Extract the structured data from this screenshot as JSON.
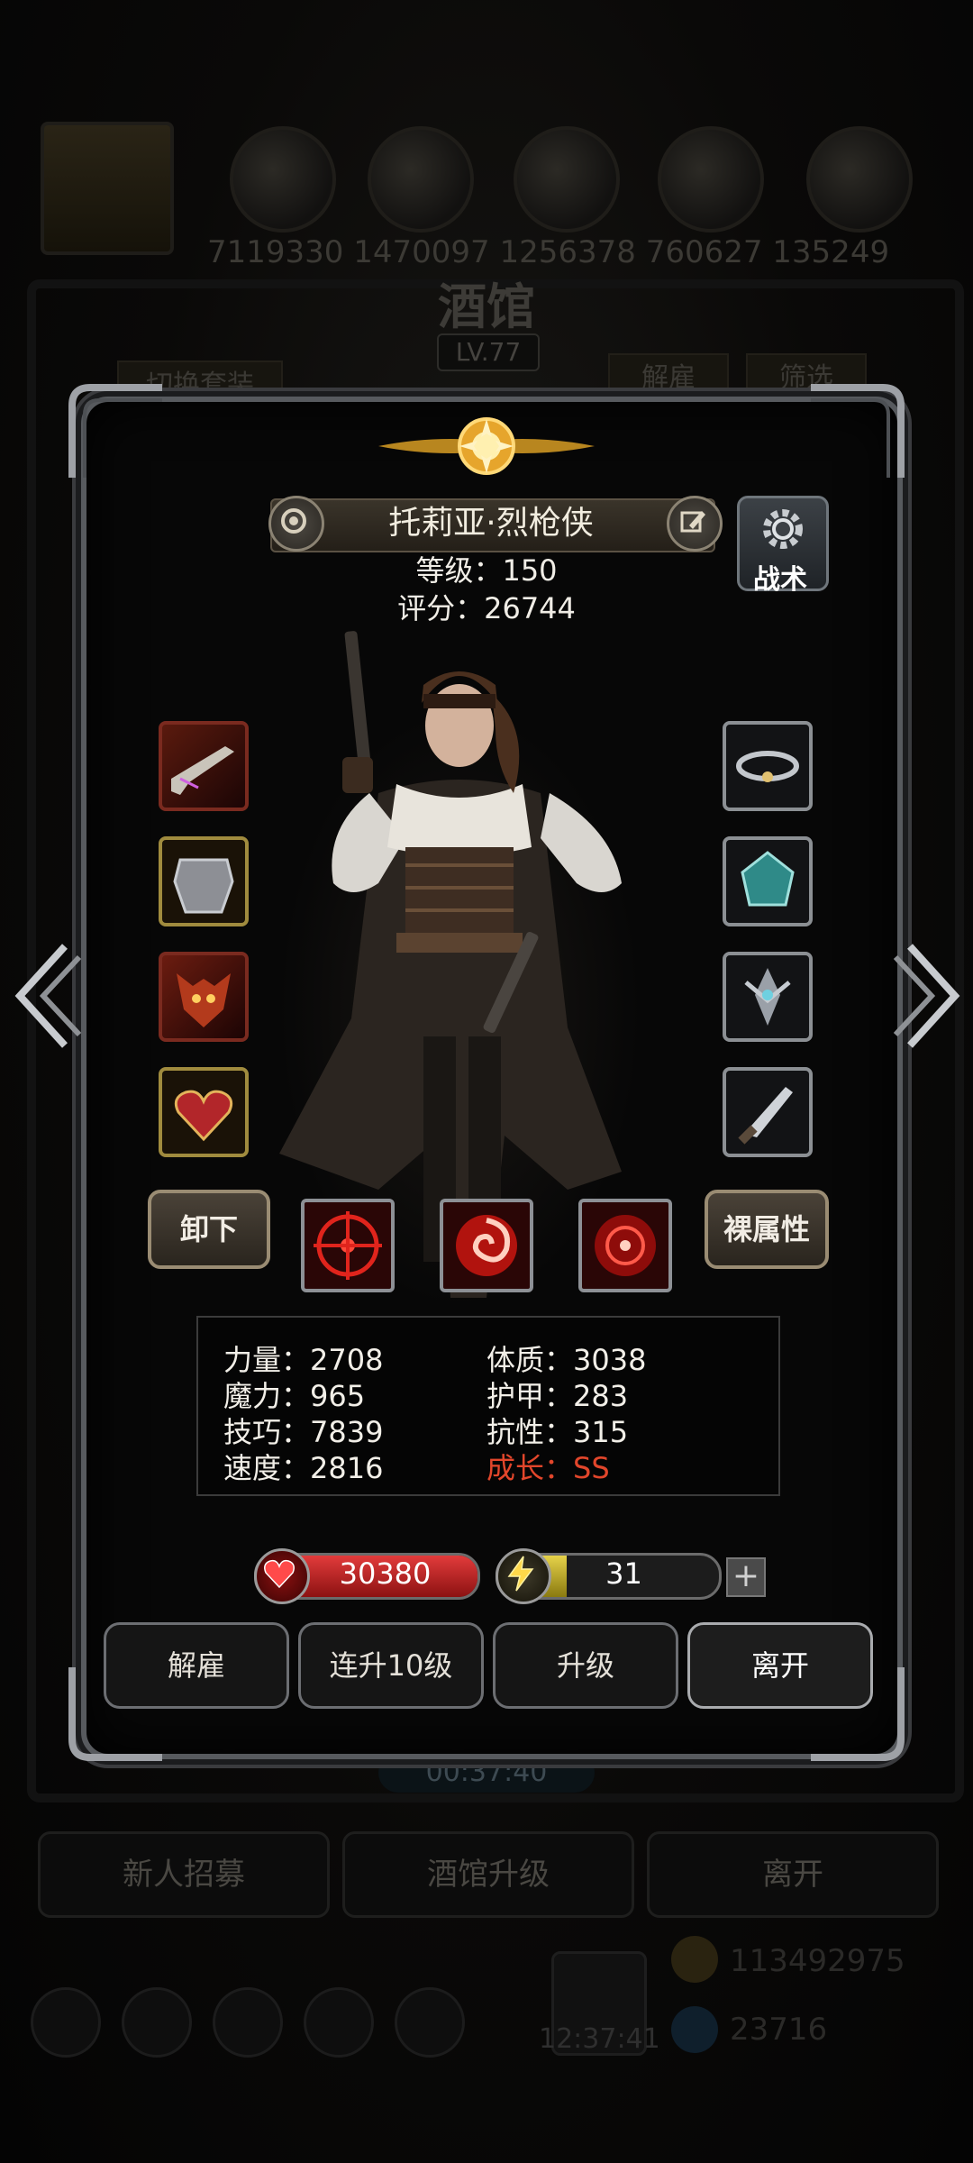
{
  "background": {
    "resource_numbers": "7119330 1470097 1256378 760627 135249",
    "tavern_title": "酒馆",
    "tavern_level": "LV.77",
    "switch_outfit": "切换套装",
    "dismiss": "解雇",
    "filter": "筛选",
    "timer": "00:37:40",
    "bottom_buttons": [
      "新人招募",
      "酒馆升级",
      "离开"
    ],
    "clock": "12:37:41",
    "gold": "113492975",
    "gems": "23716"
  },
  "hero": {
    "name": "托莉亚·烈枪侠",
    "level_label": "等级：150",
    "score_label": "评分：26744",
    "tactic": "战术"
  },
  "equipment": {
    "left": [
      "pistol-icon",
      "armor-icon",
      "demon-mask-icon",
      "heart-amulet-icon"
    ],
    "right": [
      "ring-icon",
      "gem-icon",
      "emblem-icon",
      "dagger-icon"
    ]
  },
  "actions": {
    "unequip": "卸下",
    "base_attr": "裸属性"
  },
  "skills": [
    "crosshair-skill-icon",
    "swirl-skill-icon",
    "target-skill-icon"
  ],
  "stats": {
    "strength": "力量：2708",
    "magic": "魔力：965",
    "skill": "技巧：7839",
    "speed": "速度：2816",
    "constitution": "体质：3038",
    "armor": "护甲：283",
    "resistance": "抗性：315",
    "growth": "成长：SS"
  },
  "bars": {
    "hp": "30380",
    "hp_fraction": 1.0,
    "energy": "31",
    "energy_fraction": 0.31,
    "plus": "+"
  },
  "buttons": {
    "dismiss": "解雇",
    "level10": "连升10级",
    "upgrade": "升级",
    "leave": "离开"
  },
  "colors": {
    "growth_red": "#e2462b",
    "hp_red": "#e23b3b",
    "energy_yellow": "#e6d24a"
  }
}
